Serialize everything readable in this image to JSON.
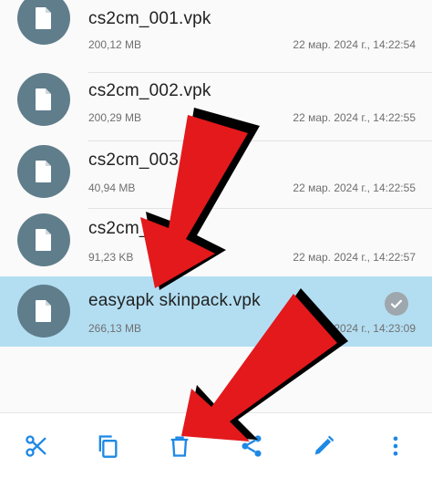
{
  "colors": {
    "accent": "#1e88e5",
    "file_icon_bg": "#607d8b",
    "selected_row_bg": "#b3def2",
    "annotation_arrow": "#e3191c"
  },
  "files": [
    {
      "name": "cs2cm_001.vpk",
      "size": "200,12 MB",
      "date": "22 мар. 2024 г., 14:22:54",
      "icon": "file-icon",
      "selected": false
    },
    {
      "name": "cs2cm_002.vpk",
      "size": "200,29 MB",
      "date": "22 мар. 2024 г., 14:22:55",
      "icon": "file-icon",
      "selected": false
    },
    {
      "name": "cs2cm_003",
      "size": "40,94 MB",
      "date": "22 мар. 2024 г., 14:22:55",
      "icon": "file-icon",
      "selected": false
    },
    {
      "name": "cs2cm_0",
      "size": "91,23 KB",
      "date": "22 мар. 2024 г., 14:22:57",
      "icon": "file-icon",
      "selected": false
    },
    {
      "name": "easyapk skinpack.vpk",
      "size": "266,13 MB",
      "date": "2024 г., 14:23:09",
      "icon": "file-icon",
      "selected": true
    }
  ],
  "toolbar": {
    "items": [
      {
        "icon": "cut-icon"
      },
      {
        "icon": "copy-icon"
      },
      {
        "icon": "delete-icon"
      },
      {
        "icon": "share-icon"
      },
      {
        "icon": "rename-icon"
      },
      {
        "icon": "more-vert-icon"
      }
    ]
  }
}
